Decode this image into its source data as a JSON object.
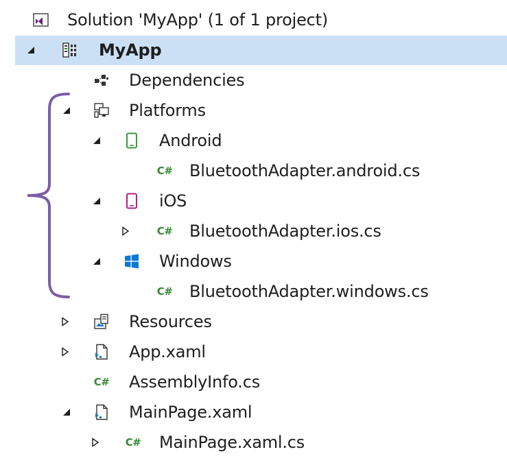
{
  "solution": {
    "label": "Solution 'MyApp' (1 of 1 project)",
    "icon": "visual-studio-solution-icon"
  },
  "project": {
    "label": "MyApp",
    "icon": "project-icon",
    "expanded": true,
    "selected": true
  },
  "nodes": {
    "dependencies": {
      "label": "Dependencies",
      "icon": "dependencies-icon"
    },
    "platforms": {
      "label": "Platforms",
      "icon": "platforms-icon",
      "expanded": true
    },
    "android": {
      "label": "Android",
      "icon": "android-device-icon",
      "expanded": true
    },
    "android_file": {
      "label": "BluetoothAdapter.android.cs",
      "icon": "csharp-file-icon"
    },
    "ios": {
      "label": "iOS",
      "icon": "ios-device-icon",
      "expanded": true
    },
    "ios_file": {
      "label": "BluetoothAdapter.ios.cs",
      "icon": "csharp-file-icon",
      "expanded": false
    },
    "windows": {
      "label": "Windows",
      "icon": "windows-logo-icon",
      "expanded": true
    },
    "windows_file": {
      "label": "BluetoothAdapter.windows.cs",
      "icon": "csharp-file-icon"
    },
    "resources": {
      "label": "Resources",
      "icon": "resources-folder-icon",
      "expanded": false
    },
    "app_xaml": {
      "label": "App.xaml",
      "icon": "xaml-file-icon",
      "expanded": false
    },
    "assemblyinfo": {
      "label": "AssemblyInfo.cs",
      "icon": "csharp-file-icon"
    },
    "mainpage_xaml": {
      "label": "MainPage.xaml",
      "icon": "xaml-file-icon",
      "expanded": true
    },
    "mainpage_cs": {
      "label": "MainPage.xaml.cs",
      "icon": "csharp-file-icon",
      "expanded": false
    }
  },
  "csharp_glyph": "C#",
  "colors": {
    "selection": "#cce0f5",
    "bracket": "#7b5ea7",
    "csharp": "#388a34",
    "android": "#3a9a3a",
    "ios": "#b0208c",
    "windows": "#0a78d4",
    "vs_purple": "#68217a"
  }
}
